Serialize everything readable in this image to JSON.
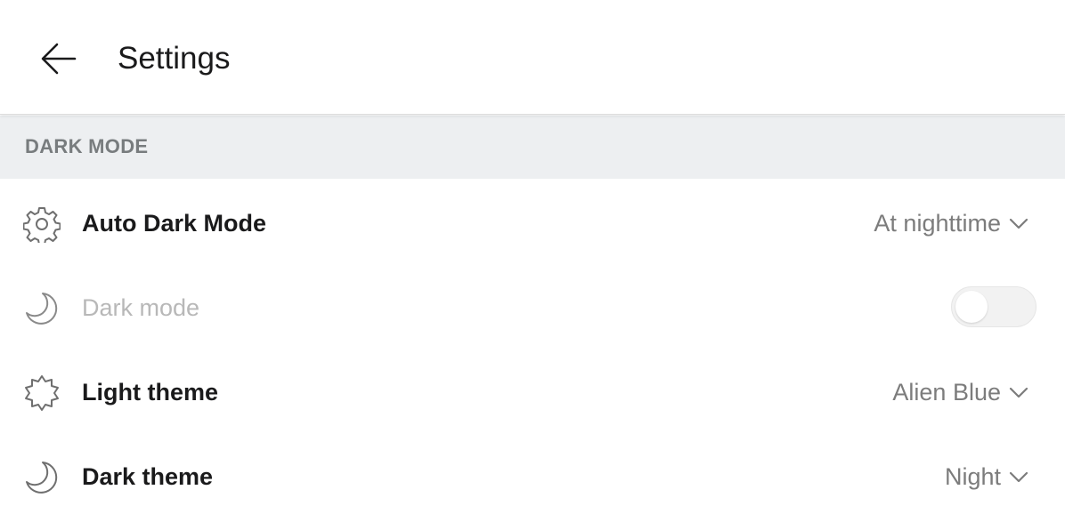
{
  "header": {
    "title": "Settings",
    "back_icon": "arrow-left-icon"
  },
  "section": {
    "title": "DARK MODE"
  },
  "rows": [
    {
      "label": "Auto Dark Mode",
      "value": "At nighttime",
      "icon": "gear-icon",
      "control": "dropdown",
      "enabled": true
    },
    {
      "label": "Dark mode",
      "icon": "moon-icon",
      "control": "toggle",
      "toggle_on": false,
      "enabled": false
    },
    {
      "label": "Light theme",
      "value": "Alien Blue",
      "icon": "sun-burst-icon",
      "control": "dropdown",
      "enabled": true
    },
    {
      "label": "Dark theme",
      "value": "Night",
      "icon": "moon-icon",
      "control": "dropdown",
      "enabled": true
    }
  ],
  "colors": {
    "section_background": "#edeff1",
    "section_text": "#787c7e",
    "label_text": "#1a1a1b",
    "value_text": "#7c7c7c",
    "disabled_text": "#b8b8b8"
  }
}
